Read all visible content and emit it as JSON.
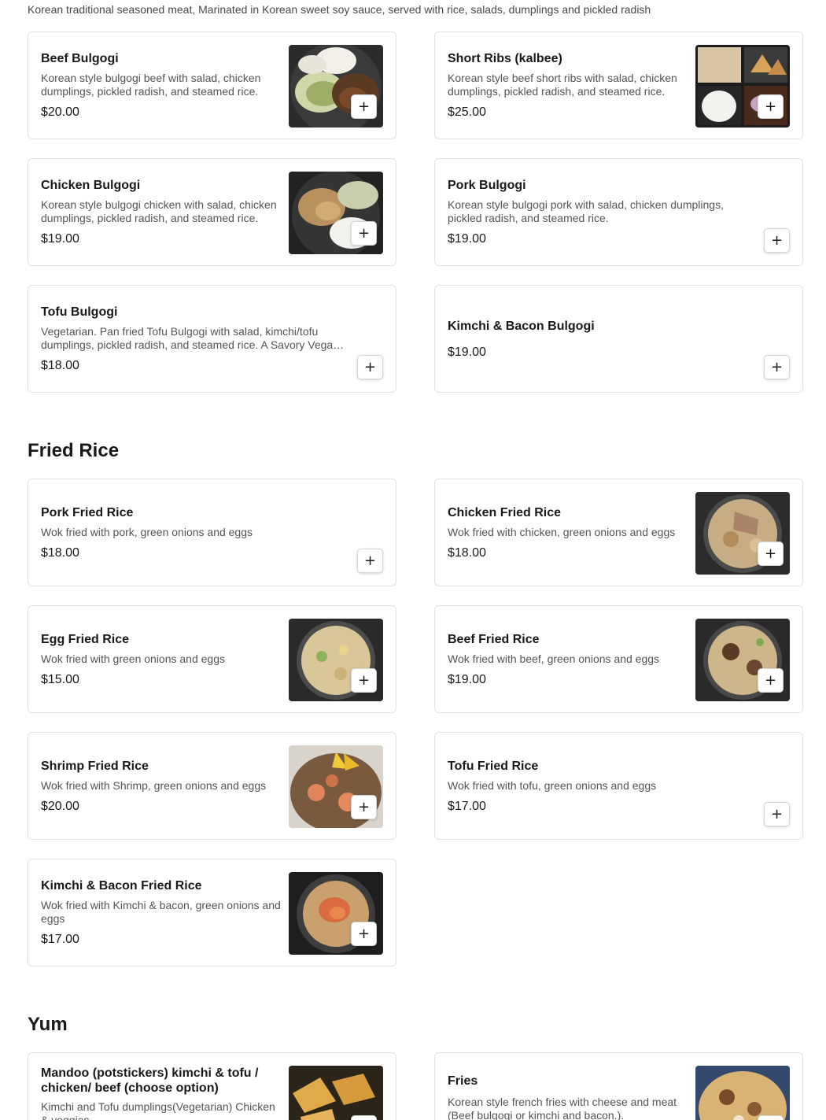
{
  "intro": "Korean traditional seasoned meat, Marinated in Korean sweet soy sauce, served with rice, salads, dumplings and pickled radish",
  "add_icon": "plus-icon",
  "bulgogi": [
    {
      "name": "Beef Bulgogi",
      "desc": "Korean style bulgogi beef with salad, chicken dumplings, pickled radish, and steamed rice.",
      "price": "$20.00"
    },
    {
      "name": "Short Ribs (kalbee)",
      "desc": "Korean style beef short ribs with salad, chicken dumplings, pickled radish, and steamed rice.",
      "price": "$25.00"
    },
    {
      "name": "Chicken Bulgogi",
      "desc": "Korean style bulgogi chicken with salad, chicken dumplings, pickled radish, and steamed rice.",
      "price": "$19.00"
    },
    {
      "name": "Pork Bulgogi",
      "desc": "Korean style bulgogi pork with salad, chicken dumplings, pickled radish, and steamed rice.",
      "price": "$19.00"
    },
    {
      "name": "Tofu Bulgogi",
      "desc": "Vegetarian. Pan fried Tofu Bulgogi with salad, kimchi/tofu dumplings, pickled radish, and steamed rice. A Savory Vegan w/o…",
      "price": "$18.00"
    },
    {
      "name": "Kimchi & Bacon Bulgogi",
      "desc": "",
      "price": "$19.00"
    }
  ],
  "fried_rice": {
    "title": "Fried Rice",
    "items": [
      {
        "name": "Pork Fried Rice",
        "desc": "Wok fried with pork, green onions and eggs",
        "price": "$18.00"
      },
      {
        "name": "Chicken Fried Rice",
        "desc": "Wok fried with chicken, green onions and eggs",
        "price": "$18.00"
      },
      {
        "name": "Egg Fried Rice",
        "desc": "Wok fried with green onions and eggs",
        "price": "$15.00"
      },
      {
        "name": "Beef Fried Rice",
        "desc": "Wok fried with beef, green onions and eggs",
        "price": "$19.00"
      },
      {
        "name": "Shrimp Fried Rice",
        "desc": "Wok fried with Shrimp, green onions and eggs",
        "price": "$20.00"
      },
      {
        "name": "Tofu Fried Rice",
        "desc": "Wok fried with tofu, green onions and eggs",
        "price": "$17.00"
      },
      {
        "name": "Kimchi & Bacon Fried Rice",
        "desc": "Wok fried with Kimchi & bacon, green onions and eggs",
        "price": "$17.00"
      }
    ]
  },
  "yum": {
    "title": "Yum",
    "items": [
      {
        "name": "Mandoo (potstickers) kimchi & tofu / chicken/ beef (choose option)",
        "desc": "Kimchi and Tofu dumplings(Vegetarian) Chicken & veggies",
        "price": ""
      },
      {
        "name": "Fries",
        "desc": "Korean style french fries with cheese and meat (Beef bulgogi or kimchi and bacon.).",
        "price": ""
      }
    ]
  },
  "colors": {
    "text": "#191919",
    "muted": "#545454",
    "border": "#e2e2e2"
  }
}
